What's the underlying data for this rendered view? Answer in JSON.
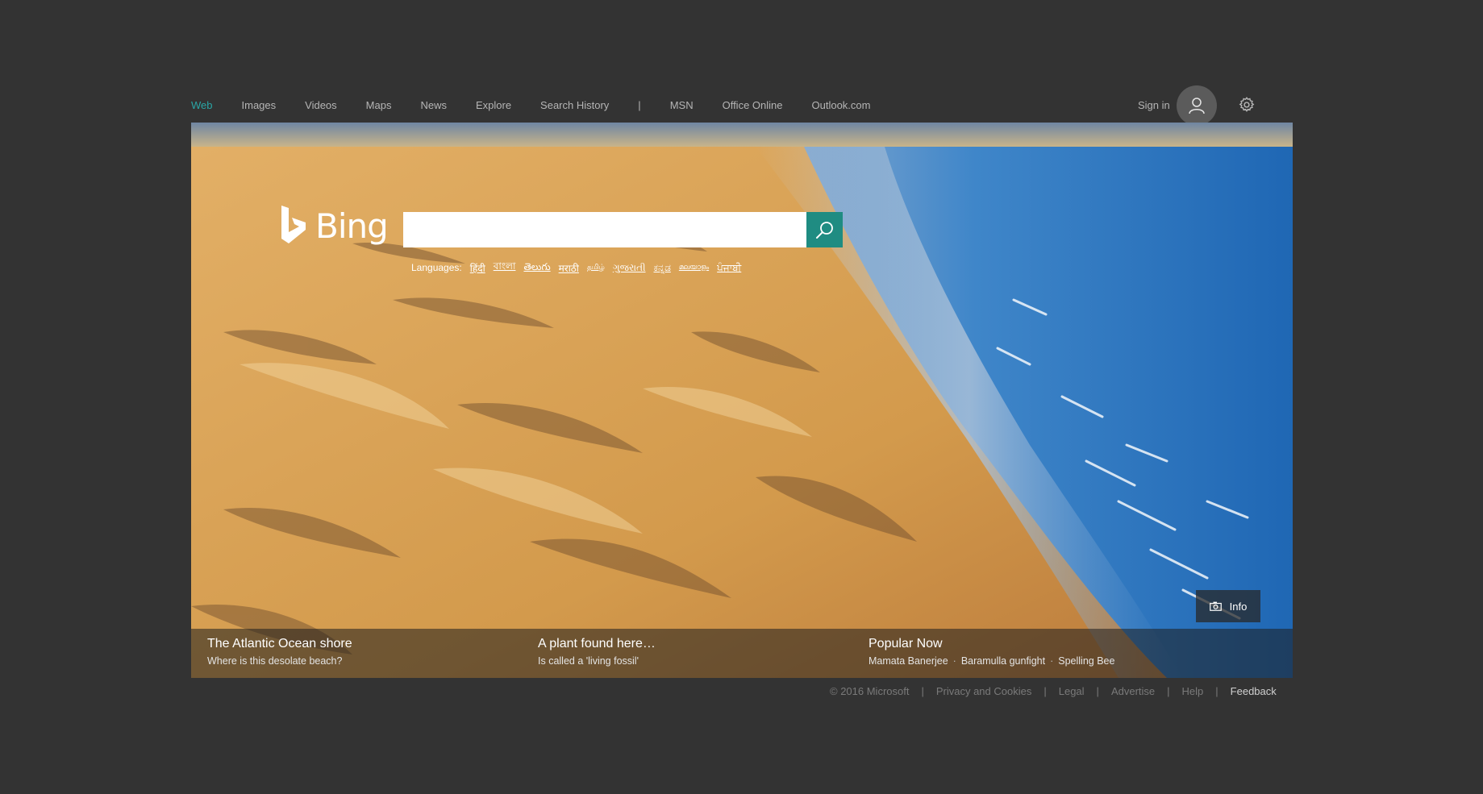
{
  "nav": {
    "items": [
      "Web",
      "Images",
      "Videos",
      "Maps",
      "News",
      "Explore",
      "Search History"
    ],
    "active": "Web",
    "separator": "|",
    "extra": [
      "MSN",
      "Office Online",
      "Outlook.com"
    ]
  },
  "account": {
    "signin_label": "Sign in",
    "avatar_icon": "user-icon",
    "settings_icon": "gear-icon"
  },
  "logo": {
    "text": "Bing"
  },
  "search": {
    "value": "",
    "placeholder": "",
    "button_icon": "search-icon",
    "accent": "#1f8c82"
  },
  "languages": {
    "label": "Languages:",
    "items": [
      "हिंदी",
      "বাংলা",
      "తెలుగు",
      "मराठी",
      "தமிழ்",
      "ગુજરાતી",
      "ಕನ್ನಡ",
      "മലയാളം",
      "ਪੰਜਾਬੀ"
    ]
  },
  "info": {
    "label": "Info",
    "icon": "camera-icon"
  },
  "stories": [
    {
      "title": "The Atlantic Ocean shore",
      "subtitle": "Where is this desolate beach?"
    },
    {
      "title": "A plant found here…",
      "subtitle": "Is called a 'living fossil'"
    }
  ],
  "popular": {
    "title": "Popular Now",
    "items": [
      "Mamata Banerjee",
      "Baramulla gunfight",
      "Spelling Bee"
    ],
    "separator": "·"
  },
  "footer": {
    "copyright": "© 2016 Microsoft",
    "links": [
      "Privacy and Cookies",
      "Legal",
      "Advertise",
      "Help"
    ],
    "feedback": "Feedback",
    "separator": "|"
  },
  "colors": {
    "page_bg": "#333333",
    "nav_active": "#2aa6a6",
    "nav_text": "#b5b5b5"
  }
}
